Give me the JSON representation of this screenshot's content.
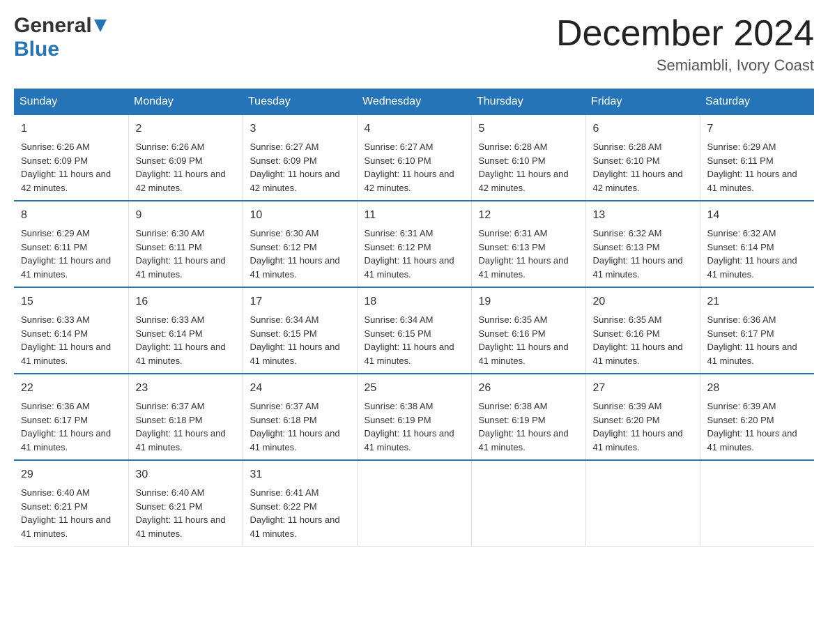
{
  "header": {
    "logo_general": "General",
    "logo_blue": "Blue",
    "month_year": "December 2024",
    "location": "Semiambli, Ivory Coast"
  },
  "days_of_week": [
    "Sunday",
    "Monday",
    "Tuesday",
    "Wednesday",
    "Thursday",
    "Friday",
    "Saturday"
  ],
  "weeks": [
    [
      {
        "day": "1",
        "sunrise": "6:26 AM",
        "sunset": "6:09 PM",
        "daylight": "11 hours and 42 minutes."
      },
      {
        "day": "2",
        "sunrise": "6:26 AM",
        "sunset": "6:09 PM",
        "daylight": "11 hours and 42 minutes."
      },
      {
        "day": "3",
        "sunrise": "6:27 AM",
        "sunset": "6:09 PM",
        "daylight": "11 hours and 42 minutes."
      },
      {
        "day": "4",
        "sunrise": "6:27 AM",
        "sunset": "6:10 PM",
        "daylight": "11 hours and 42 minutes."
      },
      {
        "day": "5",
        "sunrise": "6:28 AM",
        "sunset": "6:10 PM",
        "daylight": "11 hours and 42 minutes."
      },
      {
        "day": "6",
        "sunrise": "6:28 AM",
        "sunset": "6:10 PM",
        "daylight": "11 hours and 42 minutes."
      },
      {
        "day": "7",
        "sunrise": "6:29 AM",
        "sunset": "6:11 PM",
        "daylight": "11 hours and 41 minutes."
      }
    ],
    [
      {
        "day": "8",
        "sunrise": "6:29 AM",
        "sunset": "6:11 PM",
        "daylight": "11 hours and 41 minutes."
      },
      {
        "day": "9",
        "sunrise": "6:30 AM",
        "sunset": "6:11 PM",
        "daylight": "11 hours and 41 minutes."
      },
      {
        "day": "10",
        "sunrise": "6:30 AM",
        "sunset": "6:12 PM",
        "daylight": "11 hours and 41 minutes."
      },
      {
        "day": "11",
        "sunrise": "6:31 AM",
        "sunset": "6:12 PM",
        "daylight": "11 hours and 41 minutes."
      },
      {
        "day": "12",
        "sunrise": "6:31 AM",
        "sunset": "6:13 PM",
        "daylight": "11 hours and 41 minutes."
      },
      {
        "day": "13",
        "sunrise": "6:32 AM",
        "sunset": "6:13 PM",
        "daylight": "11 hours and 41 minutes."
      },
      {
        "day": "14",
        "sunrise": "6:32 AM",
        "sunset": "6:14 PM",
        "daylight": "11 hours and 41 minutes."
      }
    ],
    [
      {
        "day": "15",
        "sunrise": "6:33 AM",
        "sunset": "6:14 PM",
        "daylight": "11 hours and 41 minutes."
      },
      {
        "day": "16",
        "sunrise": "6:33 AM",
        "sunset": "6:14 PM",
        "daylight": "11 hours and 41 minutes."
      },
      {
        "day": "17",
        "sunrise": "6:34 AM",
        "sunset": "6:15 PM",
        "daylight": "11 hours and 41 minutes."
      },
      {
        "day": "18",
        "sunrise": "6:34 AM",
        "sunset": "6:15 PM",
        "daylight": "11 hours and 41 minutes."
      },
      {
        "day": "19",
        "sunrise": "6:35 AM",
        "sunset": "6:16 PM",
        "daylight": "11 hours and 41 minutes."
      },
      {
        "day": "20",
        "sunrise": "6:35 AM",
        "sunset": "6:16 PM",
        "daylight": "11 hours and 41 minutes."
      },
      {
        "day": "21",
        "sunrise": "6:36 AM",
        "sunset": "6:17 PM",
        "daylight": "11 hours and 41 minutes."
      }
    ],
    [
      {
        "day": "22",
        "sunrise": "6:36 AM",
        "sunset": "6:17 PM",
        "daylight": "11 hours and 41 minutes."
      },
      {
        "day": "23",
        "sunrise": "6:37 AM",
        "sunset": "6:18 PM",
        "daylight": "11 hours and 41 minutes."
      },
      {
        "day": "24",
        "sunrise": "6:37 AM",
        "sunset": "6:18 PM",
        "daylight": "11 hours and 41 minutes."
      },
      {
        "day": "25",
        "sunrise": "6:38 AM",
        "sunset": "6:19 PM",
        "daylight": "11 hours and 41 minutes."
      },
      {
        "day": "26",
        "sunrise": "6:38 AM",
        "sunset": "6:19 PM",
        "daylight": "11 hours and 41 minutes."
      },
      {
        "day": "27",
        "sunrise": "6:39 AM",
        "sunset": "6:20 PM",
        "daylight": "11 hours and 41 minutes."
      },
      {
        "day": "28",
        "sunrise": "6:39 AM",
        "sunset": "6:20 PM",
        "daylight": "11 hours and 41 minutes."
      }
    ],
    [
      {
        "day": "29",
        "sunrise": "6:40 AM",
        "sunset": "6:21 PM",
        "daylight": "11 hours and 41 minutes."
      },
      {
        "day": "30",
        "sunrise": "6:40 AM",
        "sunset": "6:21 PM",
        "daylight": "11 hours and 41 minutes."
      },
      {
        "day": "31",
        "sunrise": "6:41 AM",
        "sunset": "6:22 PM",
        "daylight": "11 hours and 41 minutes."
      },
      null,
      null,
      null,
      null
    ]
  ],
  "labels": {
    "sunrise": "Sunrise:",
    "sunset": "Sunset:",
    "daylight": "Daylight:"
  },
  "colors": {
    "header_bg": "#2574b8",
    "header_text": "#ffffff",
    "border_top": "#2574b8",
    "body_text": "#333333"
  }
}
